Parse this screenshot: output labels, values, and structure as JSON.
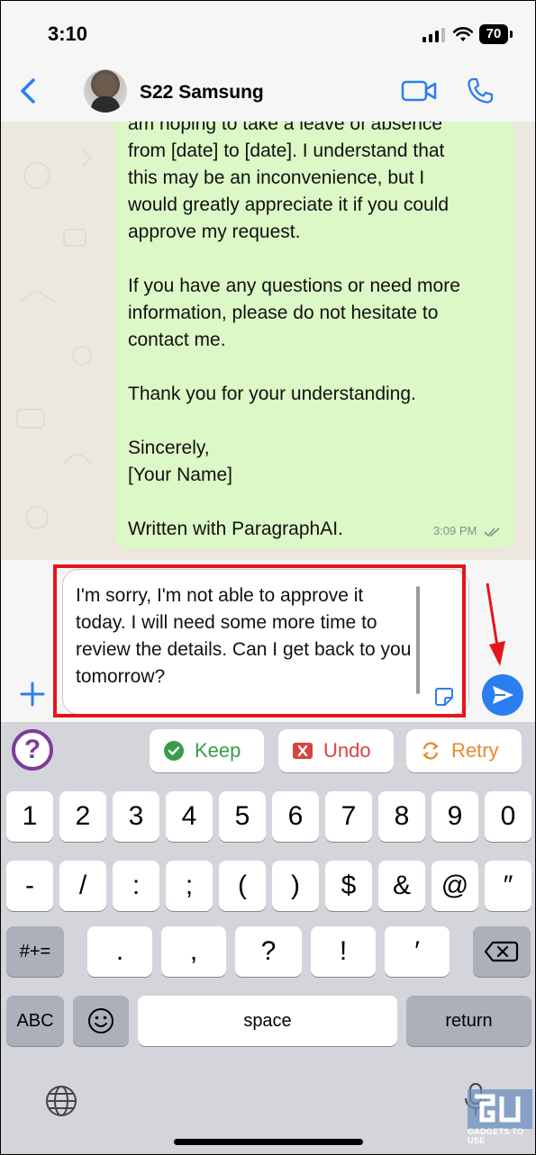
{
  "status_bar": {
    "time": "3:10",
    "battery": "70"
  },
  "header": {
    "contact_name": "S22 Samsung"
  },
  "message": {
    "text": "am hoping to take a leave of absence\nfrom [date] to [date]. I understand that\nthis may be an inconvenience, but I\nwould greatly appreciate it if you could\napprove my request.\n\nIf you have any questions or need more\ninformation, please do not hesitate to\ncontact me.\n\nThank you for your understanding.\n\nSincerely,\n[Your Name]\n\nWritten with ParagraphAI.",
    "time": "3:09 PM"
  },
  "composer": {
    "text": "I'm sorry, I'm not able to approve it today. I will need some more time to review the details. Can I get back to you tomorrow?"
  },
  "toolbar": {
    "help": "?",
    "keep": "Keep",
    "undo": "Undo",
    "retry": "Retry"
  },
  "keyboard": {
    "row1": [
      "1",
      "2",
      "3",
      "4",
      "5",
      "6",
      "7",
      "8",
      "9",
      "0"
    ],
    "row2": [
      "-",
      "/",
      ":",
      ";",
      "(",
      ")",
      "$",
      "&",
      "@",
      "″"
    ],
    "row3": {
      "mode": "#+=",
      "keys": [
        ".",
        ",",
        "?",
        "!",
        "′"
      ]
    },
    "row4": {
      "abc": "ABC",
      "space": "space",
      "return": "return"
    }
  },
  "watermark": {
    "text": "GADGETS TO USE"
  },
  "colors": {
    "bubble": "#dcf8c6",
    "accent": "#2a7ef0",
    "highlight": "#e8141b",
    "keep": "#3a9b4a",
    "undo": "#d9443e",
    "retry": "#e68a2e"
  }
}
